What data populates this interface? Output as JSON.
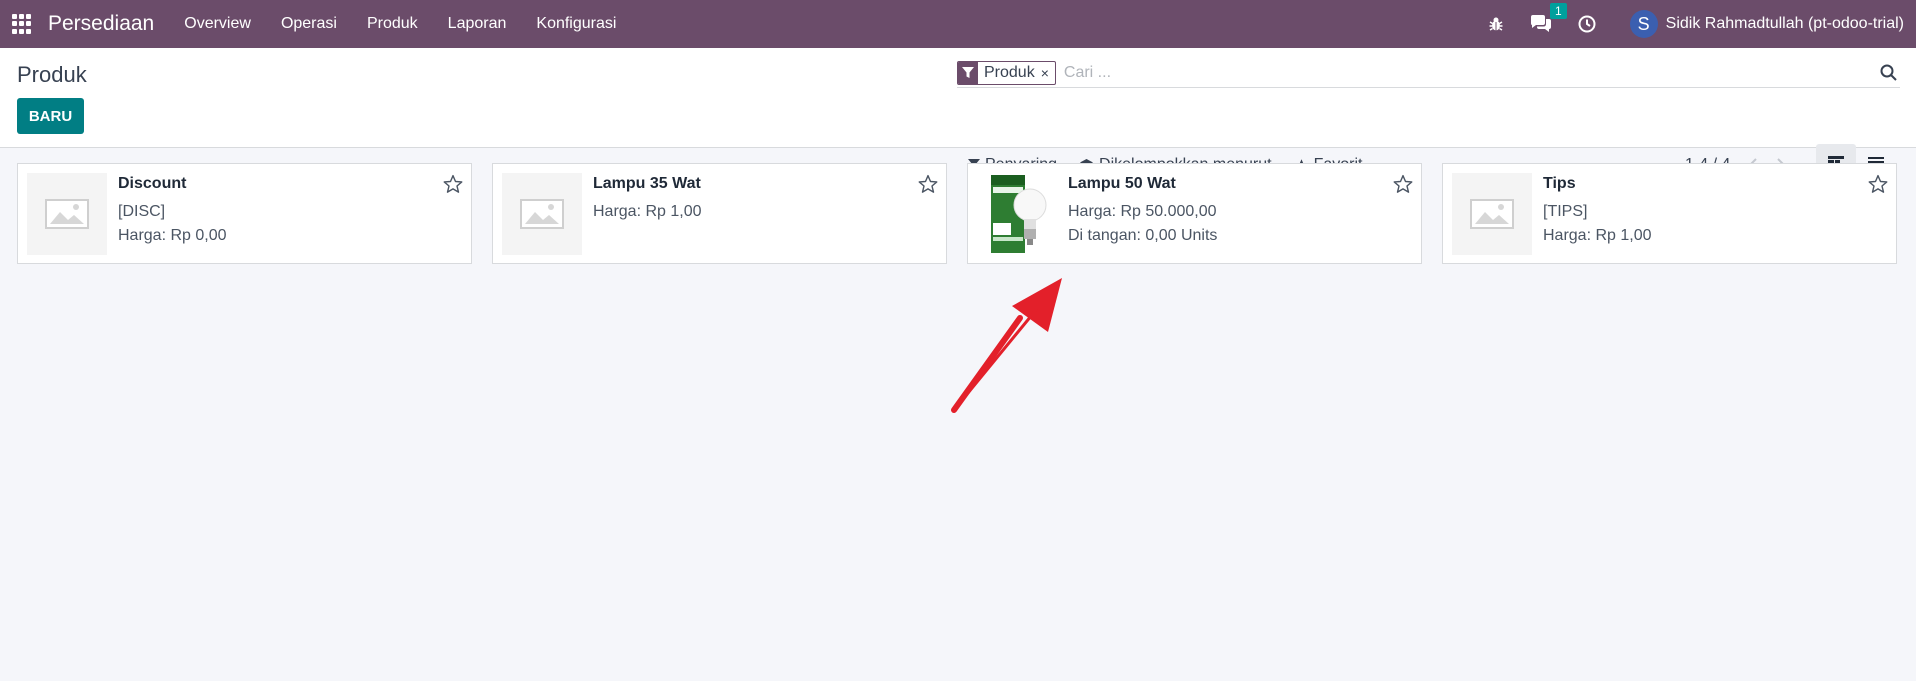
{
  "navbar": {
    "brand": "Persediaan",
    "menu": [
      "Overview",
      "Operasi",
      "Produk",
      "Laporan",
      "Konfigurasi"
    ],
    "messages_badge": "1",
    "user_initial": "S",
    "user_name": "Sidik Rahmadtullah (pt-odoo-trial)"
  },
  "control_panel": {
    "title": "Produk",
    "new_button": "BARU",
    "search": {
      "facet_label": "Produk",
      "facet_remove": "×",
      "placeholder": "Cari ..."
    },
    "filters": {
      "filter_label": "Penyaring",
      "groupby_label": "Dikelompokkan menurut",
      "favorite_label": "Favorit"
    },
    "pager": "1-4 / 4"
  },
  "products": [
    {
      "name": "Discount",
      "ref": "[DISC]",
      "price": "Harga: Rp 0,00",
      "onhand": "",
      "image": "placeholder"
    },
    {
      "name": "Lampu 35 Wat",
      "ref": "",
      "price": "Harga: Rp 1,00",
      "onhand": "",
      "image": "placeholder"
    },
    {
      "name": "Lampu 50 Wat",
      "ref": "",
      "price": "Harga: Rp 50.000,00",
      "onhand": "Di tangan: 0,00 Units",
      "image": "bulb-box"
    },
    {
      "name": "Tips",
      "ref": "[TIPS]",
      "price": "Harga: Rp 1,00",
      "onhand": "",
      "image": "placeholder"
    }
  ],
  "colors": {
    "navbar": "#6b4c6a",
    "primary_button": "#017e84",
    "badge": "#00a09d",
    "annotation_arrow": "#e3202a"
  }
}
